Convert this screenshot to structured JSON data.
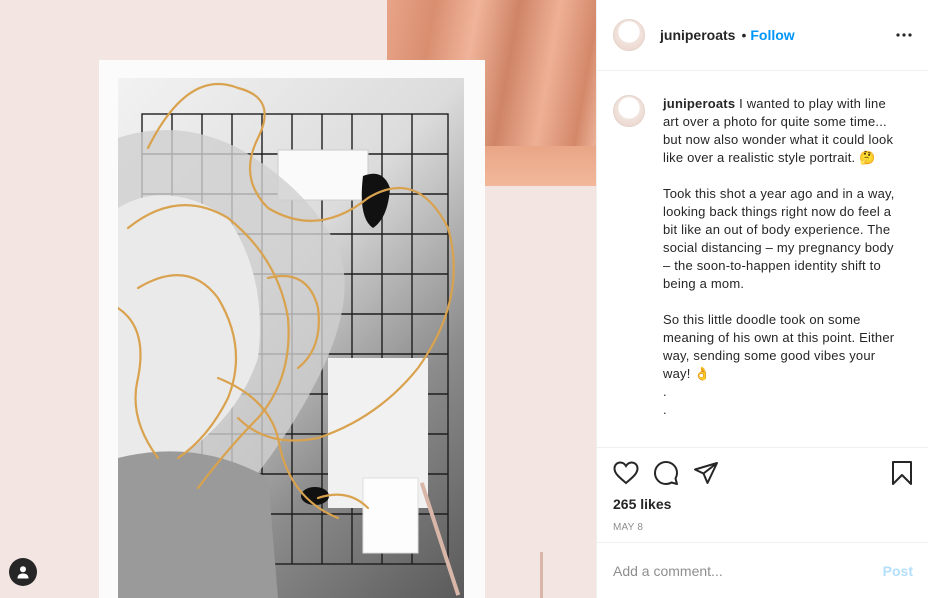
{
  "post": {
    "username": "juniperoats",
    "follow_label": "Follow",
    "separator": "•",
    "caption": {
      "username": "juniperoats",
      "paragraph1": "I wanted to play with line art over a photo for quite some time... but now also wonder what it could look like over a realistic style portrait. 🤔",
      "paragraph2": "Took this shot a year ago and in a way, looking back things right now do feel a bit like an out of body experience. The social distancing – my pregnancy body – the soon-to-happen identity shift to being a mom.",
      "paragraph3": "So this little doodle took on some meaning of his own at this point. Either way, sending some good vibes your way! 👌",
      "dot1": ".",
      "dot2": "."
    },
    "likes": "265 likes",
    "date": "MAY 8",
    "comment_placeholder": "Add a comment...",
    "post_label": "Post"
  },
  "icons": {
    "more": "more-horizontal-icon",
    "like": "heart-icon",
    "comment": "comment-icon",
    "share": "paper-plane-icon",
    "save": "bookmark-icon",
    "user_tag": "user-icon"
  },
  "colors": {
    "accent": "#0095f6",
    "post_disabled": "#b2dffc",
    "background_blush": "#f3e6e2",
    "line_art": "#d9a24e"
  }
}
